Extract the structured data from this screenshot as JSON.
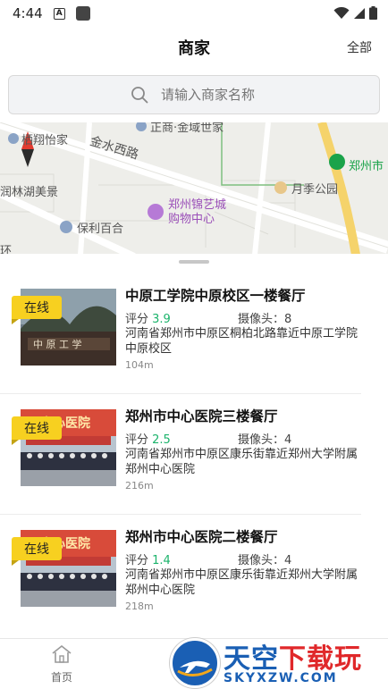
{
  "status_bar": {
    "time": "4:44",
    "a_icon_letter": "A"
  },
  "header": {
    "title": "商家",
    "all_label": "全部"
  },
  "search": {
    "placeholder": "请输入商家名称"
  },
  "map": {
    "labels": {
      "top_poi": "正商·金域世家",
      "restaurant": "栖翔怡家",
      "street": "金水西路",
      "park_green": "郑州市",
      "park": "月季公园",
      "lake": "润林湖美景",
      "mall": "郑州锦艺城\n购物中心",
      "mall_line1": "郑州锦艺城",
      "mall_line2": "购物中心",
      "baili": "保利百合",
      "edge": "环"
    }
  },
  "merchants": [
    {
      "name": "中原工学院中原校区一楼餐厅",
      "status": "在线",
      "rating_label": "评分",
      "rating": "3.9",
      "camera_label": "摄像头：",
      "cameras": "8",
      "address": "河南省郑州市中原区桐柏北路靠近中原工学院中原校区",
      "distance": "104m"
    },
    {
      "name": "郑州市中心医院三楼餐厅",
      "status": "在线",
      "rating_label": "评分",
      "rating": "2.5",
      "camera_label": "摄像头：",
      "cameras": "4",
      "address": "河南省郑州市中原区康乐街靠近郑州大学附属郑州中心医院",
      "distance": "216m"
    },
    {
      "name": "郑州市中心医院二楼餐厅",
      "status": "在线",
      "rating_label": "评分",
      "rating": "1.4",
      "camera_label": "摄像头：",
      "cameras": "4",
      "address": "河南省郑州市中原区康乐街靠近郑州大学附属郑州中心医院",
      "distance": "218m"
    }
  ],
  "bottom_nav": {
    "home_label": "首页"
  },
  "watermark": {
    "title_blue": "天空",
    "title_red": "下载玩",
    "sub": "SKYXZW.COM"
  },
  "colors": {
    "badge": "#f7d020",
    "rating": "#1bb36b",
    "map_road": "#f5d36b"
  }
}
